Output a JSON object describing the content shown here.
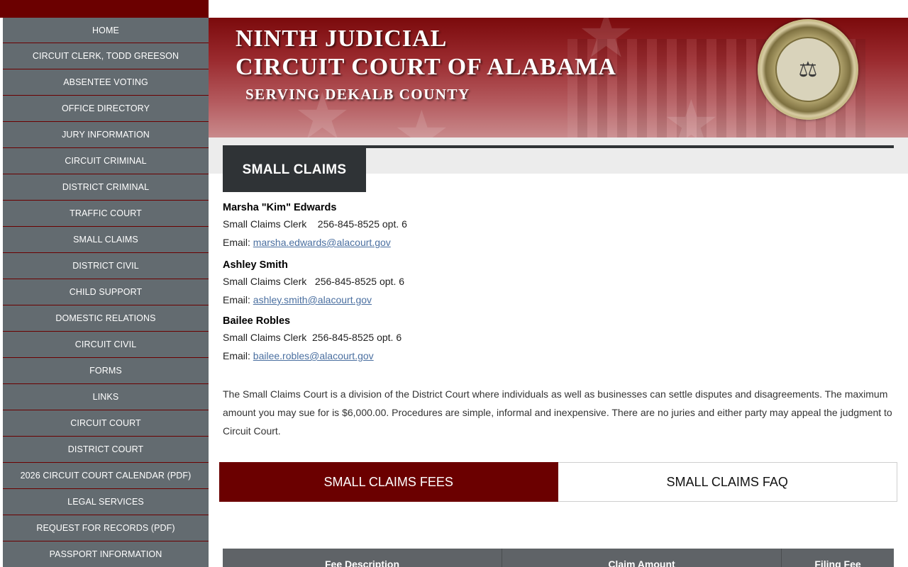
{
  "sidebar": {
    "items": [
      {
        "label": "HOME"
      },
      {
        "label": "CIRCUIT CLERK, TODD GREESON"
      },
      {
        "label": "ABSENTEE VOTING"
      },
      {
        "label": "OFFICE DIRECTORY"
      },
      {
        "label": "JURY INFORMATION"
      },
      {
        "label": "CIRCUIT CRIMINAL"
      },
      {
        "label": "DISTRICT CRIMINAL"
      },
      {
        "label": "TRAFFIC COURT"
      },
      {
        "label": "SMALL CLAIMS"
      },
      {
        "label": "DISTRICT CIVIL"
      },
      {
        "label": "CHILD SUPPORT"
      },
      {
        "label": "DOMESTIC RELATIONS"
      },
      {
        "label": "CIRCUIT CIVIL"
      },
      {
        "label": "FORMS"
      },
      {
        "label": "LINKS"
      },
      {
        "label": "CIRCUIT COURT"
      },
      {
        "label": "DISTRICT COURT"
      },
      {
        "label": "2026 CIRCUIT COURT CALENDAR (PDF)"
      },
      {
        "label": "LEGAL SERVICES"
      },
      {
        "label": "REQUEST FOR RECORDS (PDF)"
      },
      {
        "label": "PASSPORT INFORMATION"
      }
    ]
  },
  "banner": {
    "line1": "NINTH JUDICIAL",
    "line2": "CIRCUIT COURT OF ALABAMA",
    "line3": "SERVING DEKALB COUNTY",
    "seal_icon": "scales-of-justice-icon"
  },
  "page": {
    "title": "SMALL CLAIMS"
  },
  "contacts": [
    {
      "name": "Marsha \"Kim\" Edwards",
      "role_phone": "Small Claims Clerk    256-845-8525 opt. 6",
      "email_label": "Email: ",
      "email": "marsha.edwards@alacourt.gov"
    },
    {
      "name": "Ashley Smith",
      "role_phone": "Small Claims Clerk   256-845-8525 opt. 6",
      "email_label": "Email: ",
      "email": "ashley.smith@alacourt.gov"
    },
    {
      "name": "Bailee Robles",
      "role_phone": "Small Claims Clerk  256-845-8525 opt. 6",
      "email_label": "Email: ",
      "email": "bailee.robles@alacourt.gov"
    }
  ],
  "description": "The Small Claims Court is a division of the District Court where individuals as well as businesses can settle disputes and disagreements. The maximum amount you may sue for is $6,000.00. Procedures are simple, informal and inexpensive. There are no juries and either party may appeal the judgment to Circuit Court.",
  "tabs": [
    {
      "label": "SMALL CLAIMS FEES",
      "active": true
    },
    {
      "label": "SMALL CLAIMS FAQ",
      "active": false
    }
  ],
  "table": {
    "headers": [
      "Fee Description",
      "Claim Amount",
      "Filing Fee"
    ]
  },
  "colors": {
    "brand": "#6b0000",
    "nav_bg": "#636b70",
    "title_tab": "#2f3336",
    "link": "#4a6fa0"
  }
}
